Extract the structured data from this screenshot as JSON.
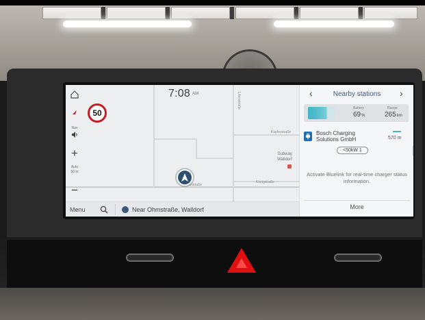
{
  "map": {
    "clock_time": "7:08",
    "clock_ampm": "AM",
    "speed_limit": "50",
    "nav_label": "Nav",
    "zoom_label_line1": "Auto",
    "zoom_label_line2": "50 m",
    "zoom_in": "+",
    "zoom_out": "−",
    "road_labels": [
      "Kupferstraße",
      "Ohmstraße",
      "Lilienstraße",
      "Königstraße"
    ],
    "poi_line1": "Subway",
    "poi_line2": "Walldorf"
  },
  "bottom_bar": {
    "menu_label": "Menu",
    "location_text": "Near Ohmstraße, Walldorf"
  },
  "panel": {
    "title": "Nearby stations",
    "prev_arrow": "‹",
    "next_arrow": "›",
    "battery_label": "Battery",
    "battery_value": "69",
    "battery_unit": "%",
    "range_label": "Range",
    "range_value": "265",
    "range_unit": "km",
    "station_name": "Bosch Charging Solutions GmbH",
    "station_distance": "570 m",
    "power_pill": "<50kW 1",
    "bluelink_message": "Activate Bluelink for real-time charger status information.",
    "more_label": "More"
  },
  "colors": {
    "speed_sign_ring": "#c41e24",
    "accent_blue": "#3a5a7a",
    "battery_teal": "#46b6c7",
    "hazard_red": "#e01010"
  },
  "icons": [
    "home-icon",
    "compass-icon",
    "speaker-icon",
    "search-icon",
    "location-icon",
    "plug-icon",
    "car-arrow-icon",
    "hazard-icon"
  ]
}
